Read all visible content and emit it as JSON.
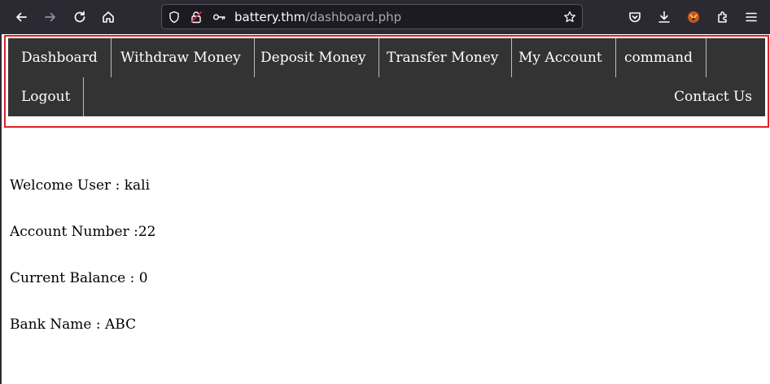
{
  "browser": {
    "url_host": "battery.thm",
    "url_path": "/dashboard.php",
    "icons": [
      "back-icon",
      "forward-icon",
      "reload-icon",
      "home-icon",
      "shield-icon",
      "lock-insecure-icon",
      "key-icon",
      "bookmark-star-icon",
      "pocket-icon",
      "download-icon",
      "extension-icon",
      "puzzle-icon",
      "menu-icon"
    ]
  },
  "nav": {
    "items": [
      {
        "label": "Dashboard"
      },
      {
        "label": "Withdraw Money"
      },
      {
        "label": "Deposit Money"
      },
      {
        "label": "Transfer Money"
      },
      {
        "label": "My Account"
      },
      {
        "label": "command"
      },
      {
        "label": "Logout"
      }
    ],
    "contact": "Contact Us"
  },
  "account": {
    "welcome": "Welcome User : kali",
    "number": "Account Number :22",
    "balance": "Current Balance : 0",
    "bank": "Bank Name : ABC"
  },
  "colors": {
    "chrome_bg": "#2b2a33",
    "navbar_bg": "#333333",
    "highlight_border": "#e0202a"
  }
}
